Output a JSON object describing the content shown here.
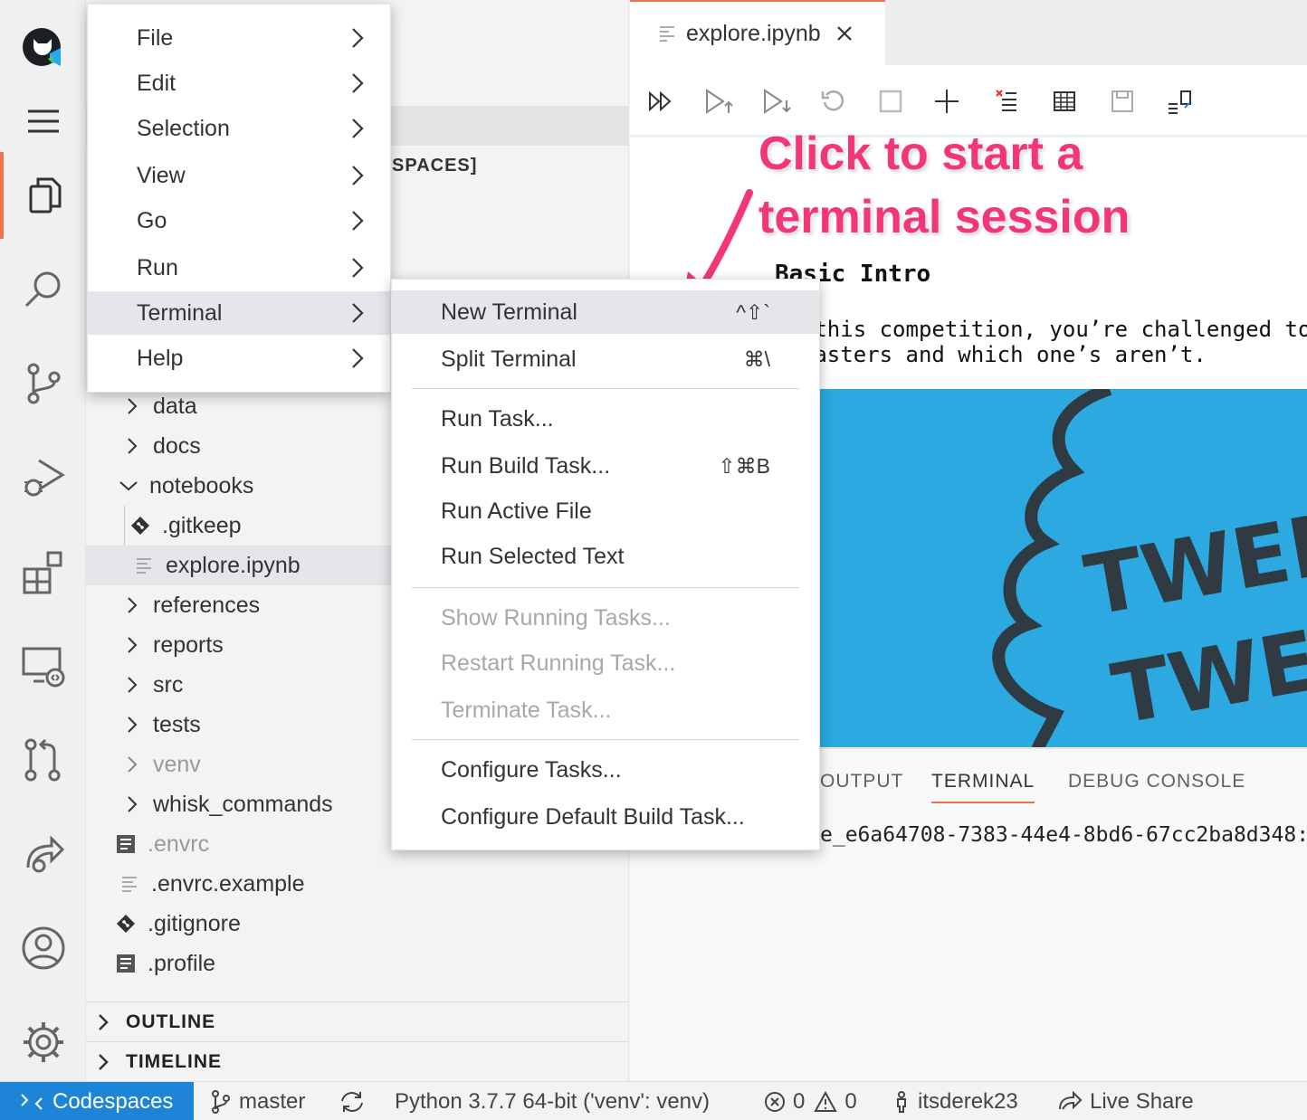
{
  "activity_bar": {
    "items": [
      "github-codespaces-logo",
      "menu-icon",
      "files-icon",
      "search-icon",
      "source-control-icon",
      "run-debug-icon",
      "extensions-icon",
      "remote-explorer-icon",
      "pull-requests-icon",
      "live-share-icon",
      "accounts-icon",
      "settings-gear-icon"
    ],
    "active": "files-icon",
    "accent_color": "#f26f4f"
  },
  "explorer": {
    "workspace_title": "SPACES]",
    "tree": [
      {
        "label": "data",
        "type": "folder",
        "expanded": false
      },
      {
        "label": "docs",
        "type": "folder",
        "expanded": false
      },
      {
        "label": "notebooks",
        "type": "folder",
        "expanded": true
      },
      {
        "label": ".gitkeep",
        "type": "git-file"
      },
      {
        "label": "explore.ipynb",
        "type": "notebook-file",
        "selected": true
      },
      {
        "label": "references",
        "type": "folder",
        "expanded": false
      },
      {
        "label": "reports",
        "type": "folder",
        "expanded": false
      },
      {
        "label": "src",
        "type": "folder",
        "expanded": false
      },
      {
        "label": "tests",
        "type": "folder",
        "expanded": false
      },
      {
        "label": "venv",
        "type": "folder",
        "expanded": false,
        "dimmed": true
      },
      {
        "label": "whisk_commands",
        "type": "folder",
        "expanded": false
      },
      {
        "label": ".envrc",
        "type": "file",
        "dimmed": true
      },
      {
        "label": ".envrc.example",
        "type": "text-file"
      },
      {
        "label": ".gitignore",
        "type": "git-file"
      },
      {
        "label": ".profile",
        "type": "file"
      }
    ],
    "sections": {
      "outline": "OUTLINE",
      "timeline": "TIMELINE"
    }
  },
  "main_menu": {
    "items": [
      "File",
      "Edit",
      "Selection",
      "View",
      "Go",
      "Run",
      "Terminal",
      "Help"
    ],
    "highlighted": "Terminal"
  },
  "terminal_submenu": {
    "groups": [
      [
        {
          "label": "New Terminal",
          "shortcut": "^⇧`",
          "highlighted": true
        },
        {
          "label": "Split Terminal",
          "shortcut": "⌘\\"
        }
      ],
      [
        {
          "label": "Run Task..."
        },
        {
          "label": "Run Build Task...",
          "shortcut": "⇧⌘B"
        },
        {
          "label": "Run Active File"
        },
        {
          "label": "Run Selected Text"
        }
      ],
      [
        {
          "label": "Show Running Tasks...",
          "disabled": true
        },
        {
          "label": "Restart Running Task...",
          "disabled": true
        },
        {
          "label": "Terminate Task...",
          "disabled": true
        }
      ],
      [
        {
          "label": "Configure Tasks..."
        },
        {
          "label": "Configure Default Build Task..."
        }
      ]
    ]
  },
  "editor": {
    "tab_label": "explore.ipynb",
    "toolbar": [
      "run-all-icon",
      "run-above-icon",
      "run-below-icon",
      "restart-kernel-icon",
      "interrupt-kernel-icon",
      "add-cell-icon",
      "clear-outputs-icon",
      "variables-icon",
      "save-icon",
      "export-icon"
    ],
    "markdown": {
      "heading": "Basic Intro",
      "lines": [
        "In this competition, you’re challenged to",
        "disasters and which one’s aren’t."
      ]
    },
    "image_text": [
      "TWEET",
      "TWEET"
    ],
    "image_color": "#2ba9e0"
  },
  "annotation": {
    "lines": [
      "Click to start a",
      "terminal session"
    ],
    "color": "#f3357a"
  },
  "panel": {
    "tabs": [
      "OUTPUT",
      "TERMINAL",
      "DEBUG CONSOLE"
    ],
    "active_tab": "TERMINAL",
    "terminal_text": "e_e6a64708-7383-44e4-8bd6-67cc2ba8d348:"
  },
  "status_bar": {
    "remote": "Codespaces",
    "branch": "master",
    "python": "Python 3.7.7 64-bit ('venv': venv)",
    "errors": "0",
    "warnings": "0",
    "user": "itsderek23",
    "live_share": "Live Share",
    "remote_color": "#1e84d8"
  }
}
